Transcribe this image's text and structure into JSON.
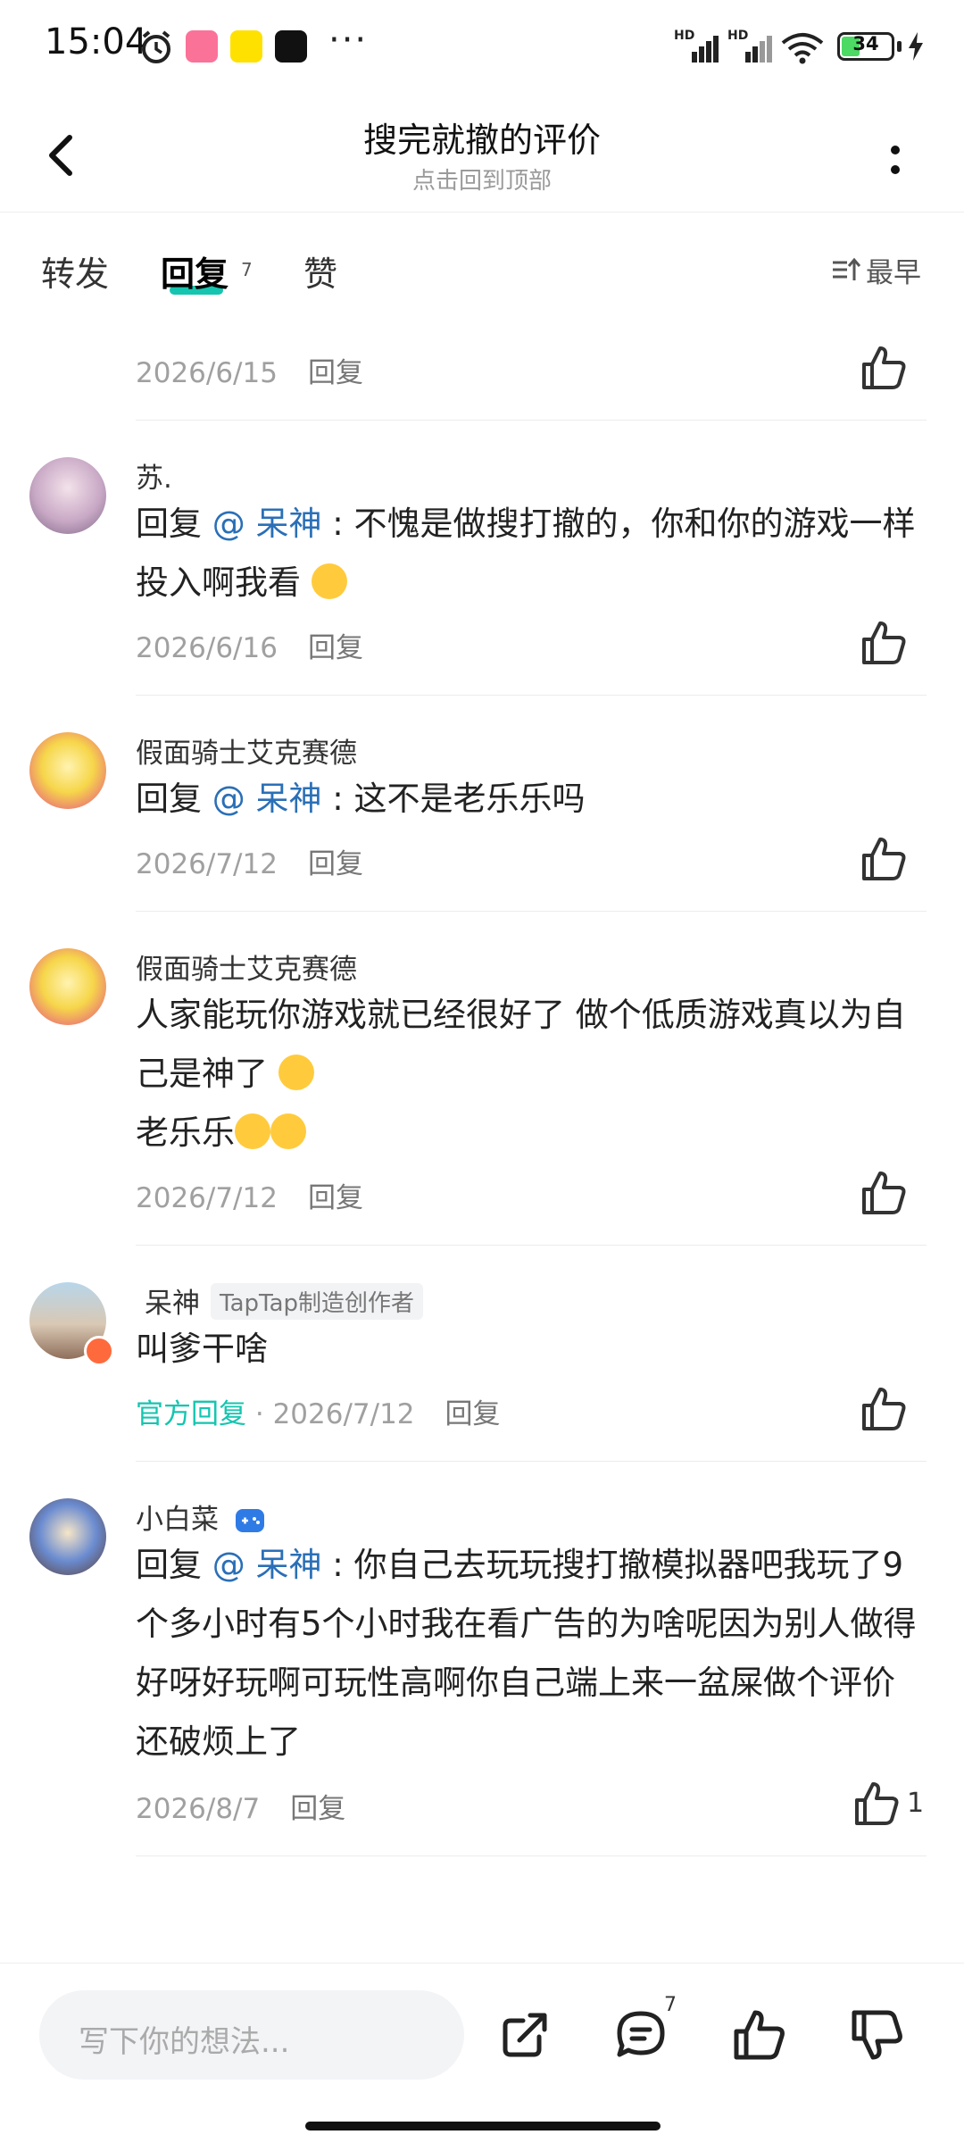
{
  "status": {
    "time": "15:04",
    "more": "···",
    "battery": "34",
    "net1": "HD",
    "net2": "HD"
  },
  "header": {
    "title": "搜完就撤的评价",
    "subtitle": "点击回到顶部"
  },
  "tabs": {
    "forward": "转发",
    "reply": "回复",
    "reply_count": "7",
    "like": "赞",
    "sort": "最早"
  },
  "comments": [
    {
      "date": "2026/6/15",
      "reply": "回复"
    },
    {
      "name": "苏.",
      "prefix": "回复 ",
      "mention": "@ 呆神",
      "text": " : 不愧是做搜打撤的，你和你的游戏一样投入啊我看",
      "date": "2026/6/16",
      "reply": "回复"
    },
    {
      "name": "假面骑士艾克赛德",
      "prefix": "回复 ",
      "mention": "@ 呆神",
      "text": " : 这不是老乐乐吗",
      "date": "2026/7/12",
      "reply": "回复"
    },
    {
      "name": "假面骑士艾克赛德",
      "line1": "人家能玩你游戏就已经很好了 做个低质游戏真以为自己是神了",
      "line2": "老乐乐",
      "date": "2026/7/12",
      "reply": "回复"
    },
    {
      "name": "呆神",
      "badge": "TapTap制造创作者",
      "text": "叫爹干啥",
      "official": "官方回复",
      "dot": " · ",
      "date": "2026/7/12",
      "reply": "回复"
    },
    {
      "name": "小白菜",
      "prefix": "回复 ",
      "mention": "@ 呆神",
      "text": " : 你自己去玩玩搜打撤模拟器吧我玩了9个多小时有5个小时我在看广告的为啥呢因为别人做得好呀好玩啊可玩性高啊你自己端上来一盆屎做个评价还破烦上了",
      "date": "2026/8/7",
      "reply": "回复",
      "likes": "1"
    }
  ],
  "bottom": {
    "placeholder": "写下你的想法...",
    "comment_count": "7"
  },
  "colors": {
    "accent": "#15c5b0",
    "mention": "#2a6fb7"
  }
}
